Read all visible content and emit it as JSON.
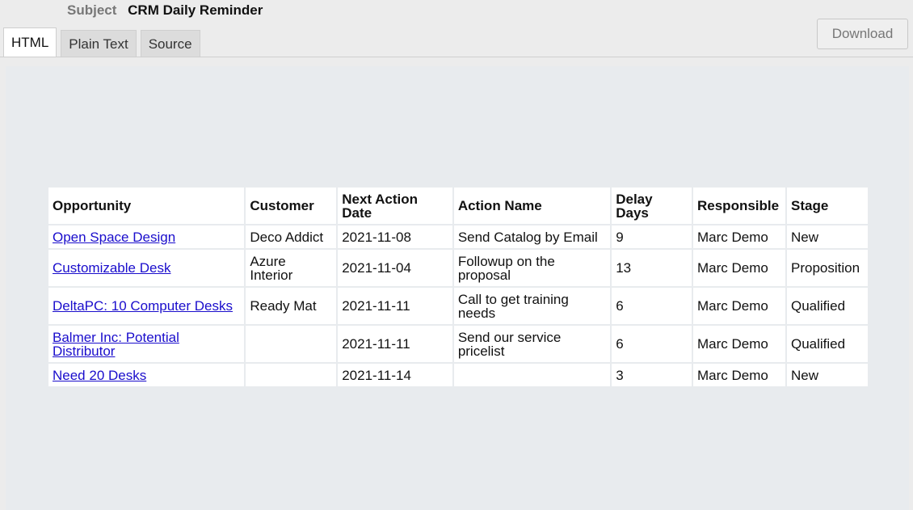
{
  "email": {
    "subject_label": "Subject",
    "subject": "CRM Daily Reminder"
  },
  "tabs": [
    {
      "label": "HTML",
      "active": true
    },
    {
      "label": "Plain Text",
      "active": false
    },
    {
      "label": "Source",
      "active": false
    }
  ],
  "download_label": "Download",
  "table": {
    "headers": [
      "Opportunity",
      "Customer",
      "Next Action Date",
      "Action Name",
      "Delay Days",
      "Responsible",
      "Stage"
    ],
    "rows": [
      {
        "opportunity": "Open Space Design",
        "customer": "Deco Addict",
        "next_action_date": "2021-11-08",
        "action_name": "Send Catalog by Email",
        "delay_days": "9",
        "responsible": "Marc Demo",
        "stage": "New"
      },
      {
        "opportunity": "Customizable Desk",
        "customer": "Azure Interior",
        "next_action_date": "2021-11-04",
        "action_name": "Followup on the proposal",
        "delay_days": "13",
        "responsible": "Marc Demo",
        "stage": "Proposition"
      },
      {
        "opportunity": "DeltaPC: 10 Computer Desks",
        "customer": "Ready Mat",
        "next_action_date": "2021-11-11",
        "action_name": "Call to get training needs",
        "delay_days": "6",
        "responsible": "Marc Demo",
        "stage": "Qualified"
      },
      {
        "opportunity": "Balmer Inc: Potential Distributor",
        "customer": "",
        "next_action_date": "2021-11-11",
        "action_name": "Send our service pricelist",
        "delay_days": "6",
        "responsible": "Marc Demo",
        "stage": "Qualified"
      },
      {
        "opportunity": "Need 20 Desks",
        "customer": "",
        "next_action_date": "2021-11-14",
        "action_name": "",
        "delay_days": "3",
        "responsible": "Marc Demo",
        "stage": "New"
      }
    ]
  }
}
